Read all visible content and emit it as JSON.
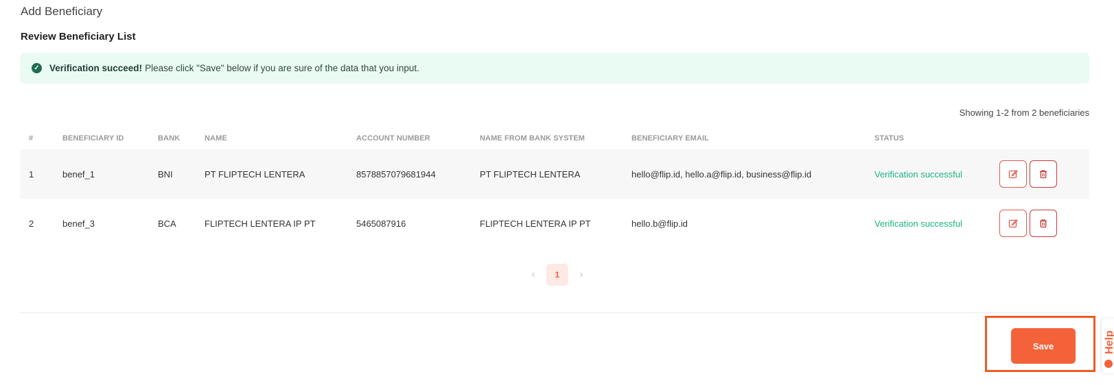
{
  "header": {
    "title": "Add Beneficiary",
    "section_title": "Review Beneficiary List"
  },
  "alert": {
    "icon": "check-circle-icon",
    "strong": "Verification succeed!",
    "message": "Please click \"Save\" below if you are sure of the data that you input."
  },
  "showing_text": "Showing 1-2 from 2 beneficiaries",
  "table": {
    "headers": [
      "#",
      "BENEFICIARY ID",
      "BANK",
      "NAME",
      "ACCOUNT NUMBER",
      "NAME FROM BANK SYSTEM",
      "BENEFICIARY EMAIL",
      "STATUS"
    ],
    "rows": [
      {
        "num": "1",
        "beneficiary_id": "benef_1",
        "bank": "BNI",
        "name": "PT FLIPTECH LENTERA",
        "account_number": "8578857079681944",
        "name_from_bank": "PT FLIPTECH LENTERA",
        "email": "hello@flip.id, hello.a@flip.id, business@flip.id",
        "status": "Verification successful"
      },
      {
        "num": "2",
        "beneficiary_id": "benef_3",
        "bank": "BCA",
        "name": "FLIPTECH LENTERA IP PT",
        "account_number": "5465087916",
        "name_from_bank": "FLIPTECH LENTERA IP PT",
        "email": "hello.b@flip.id",
        "status": "Verification successful"
      }
    ]
  },
  "pagination": {
    "current_page": "1"
  },
  "footer": {
    "save_label": "Save"
  },
  "help": {
    "label": "Help"
  },
  "colors": {
    "accent": "#f4623a",
    "success": "#1bb283",
    "alert_bg": "#e9fbf3"
  }
}
